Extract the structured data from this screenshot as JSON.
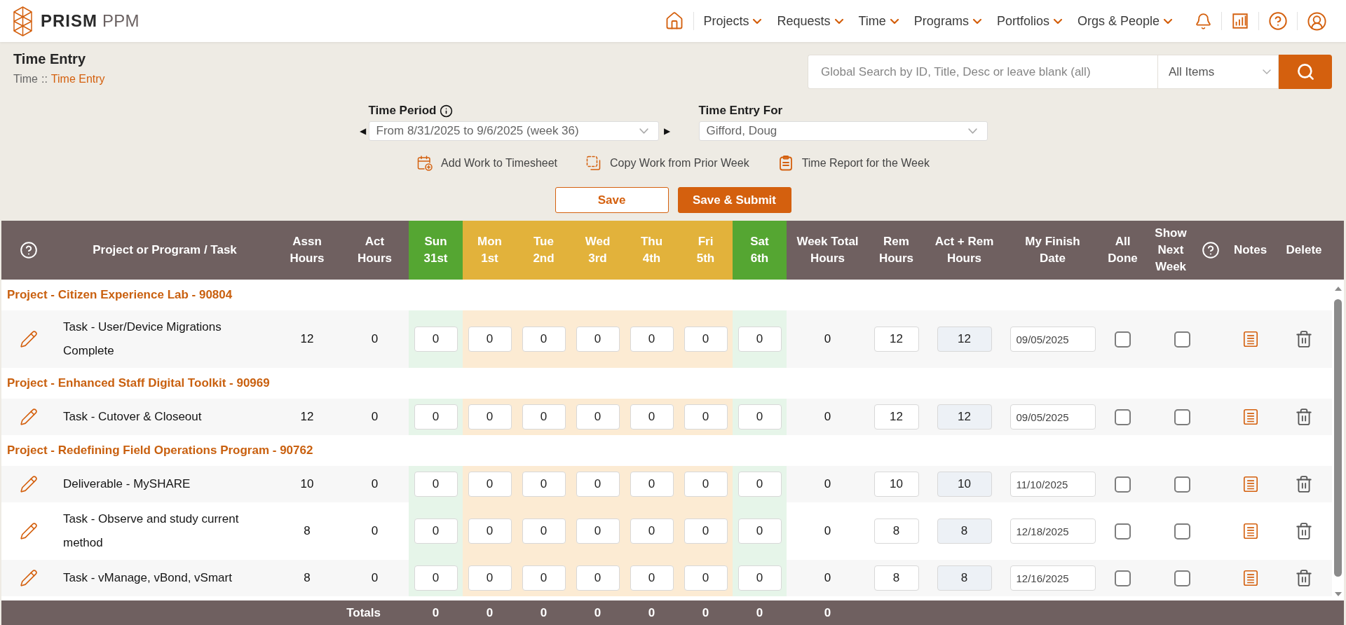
{
  "header": {
    "logo_text": "**PRISM** PPM",
    "menus": [
      {
        "label": "Projects"
      },
      {
        "label": "Requests"
      },
      {
        "label": "Time"
      },
      {
        "label": "Programs"
      },
      {
        "label": "Portfolios"
      },
      {
        "label": "Orgs & People"
      }
    ]
  },
  "page": {
    "title": "Time Entry",
    "breadcrumb": [
      {
        "label": "Time",
        "current": false
      },
      {
        "label": "Time Entry",
        "current": true
      }
    ],
    "breadcrumb_separator": "::"
  },
  "search": {
    "placeholder": "Global Search by ID, Title, Desc or leave blank (all)",
    "scope": "All Items"
  },
  "time_period": {
    "label": "Time Period",
    "previous": "◀",
    "value": "From 8/31/2025 to 9/6/2025 (week 36)",
    "next": "▶"
  },
  "time_entry_for": {
    "label": "Time Entry For",
    "value": "Gifford, Doug"
  },
  "actions": [
    {
      "kind": "add",
      "label": "Add Work to Timesheet"
    },
    {
      "kind": "copy",
      "label": "Copy Work from Prior Week"
    },
    {
      "kind": "report",
      "label": "Time Report for the Week"
    }
  ],
  "buttons": [
    {
      "kind": "secondary",
      "label": "Save"
    },
    {
      "kind": "primary",
      "label": "Save & Submit"
    }
  ],
  "table": {
    "columns": [
      {
        "kind": "help"
      },
      {
        "kind": "text",
        "lines": [
          "Project or Program / Task"
        ]
      },
      {
        "kind": "text",
        "lines": [
          "Assn",
          "Hours"
        ]
      },
      {
        "kind": "text",
        "lines": [
          "Act",
          "Hours"
        ]
      },
      {
        "kind": "day",
        "lines": [
          "Sun",
          "31st"
        ],
        "weekend": true
      },
      {
        "kind": "day",
        "lines": [
          "Mon",
          "1st"
        ],
        "weekend": false
      },
      {
        "kind": "day",
        "lines": [
          "Tue",
          "2nd"
        ],
        "weekend": false
      },
      {
        "kind": "day",
        "lines": [
          "Wed",
          "3rd"
        ],
        "weekend": false
      },
      {
        "kind": "day",
        "lines": [
          "Thu",
          "4th"
        ],
        "weekend": false
      },
      {
        "kind": "day",
        "lines": [
          "Fri",
          "5th"
        ],
        "weekend": false
      },
      {
        "kind": "day",
        "lines": [
          "Sat",
          "6th"
        ],
        "weekend": true
      },
      {
        "kind": "text",
        "lines": [
          "Week Total",
          "Hours"
        ]
      },
      {
        "kind": "text",
        "lines": [
          "Rem",
          "Hours"
        ]
      },
      {
        "kind": "text",
        "lines": [
          "Act + Rem",
          "Hours"
        ]
      },
      {
        "kind": "text",
        "lines": [
          "My Finish",
          "Date"
        ]
      },
      {
        "kind": "text",
        "lines": [
          "All",
          "Done"
        ]
      },
      {
        "kind": "text",
        "lines": [
          "Show",
          "Next",
          "Week"
        ]
      },
      {
        "kind": "help"
      },
      {
        "kind": "text",
        "lines": [
          "Notes"
        ]
      },
      {
        "kind": "text",
        "lines": [
          "Delete"
        ]
      }
    ],
    "groups": [
      {
        "title": "Project - Citizen Experience Lab - 90804",
        "tasks": [
          {
            "name": "Task - User/Device Migrations Complete",
            "assigned": "12",
            "actual": "0",
            "days": [
              "0",
              "0",
              "0",
              "0",
              "0",
              "0",
              "0"
            ],
            "week_total": "0",
            "remaining": "12",
            "actual_plus_remaining": "12",
            "finish_date": "09/05/2025",
            "all_done": false,
            "show_next_week": false
          }
        ]
      },
      {
        "title": "Project - Enhanced Staff Digital Toolkit - 90969",
        "tasks": [
          {
            "name": "Task - Cutover & Closeout",
            "assigned": "12",
            "actual": "0",
            "days": [
              "0",
              "0",
              "0",
              "0",
              "0",
              "0",
              "0"
            ],
            "week_total": "0",
            "remaining": "12",
            "actual_plus_remaining": "12",
            "finish_date": "09/05/2025",
            "all_done": false,
            "show_next_week": false
          }
        ]
      },
      {
        "title": "Project - Redefining Field Operations Program - 90762",
        "tasks": [
          {
            "name": "Deliverable - MySHARE",
            "assigned": "10",
            "actual": "0",
            "days": [
              "0",
              "0",
              "0",
              "0",
              "0",
              "0",
              "0"
            ],
            "week_total": "0",
            "remaining": "10",
            "actual_plus_remaining": "10",
            "finish_date": "11/10/2025",
            "all_done": false,
            "show_next_week": false
          },
          {
            "name": "Task - Observe and study current method",
            "assigned": "8",
            "actual": "0",
            "days": [
              "0",
              "0",
              "0",
              "0",
              "0",
              "0",
              "0"
            ],
            "week_total": "0",
            "remaining": "8",
            "actual_plus_remaining": "8",
            "finish_date": "12/18/2025",
            "all_done": false,
            "show_next_week": false
          },
          {
            "name": "Task - vManage, vBond, vSmart",
            "assigned": "8",
            "actual": "0",
            "days": [
              "0",
              "0",
              "0",
              "0",
              "0",
              "0",
              "0"
            ],
            "week_total": "0",
            "remaining": "8",
            "actual_plus_remaining": "8",
            "finish_date": "12/16/2025",
            "all_done": false,
            "show_next_week": false
          }
        ]
      }
    ],
    "totals": {
      "label": "Totals",
      "days": [
        "0",
        "0",
        "0",
        "0",
        "0",
        "0",
        "0"
      ],
      "week_total": "0"
    }
  }
}
